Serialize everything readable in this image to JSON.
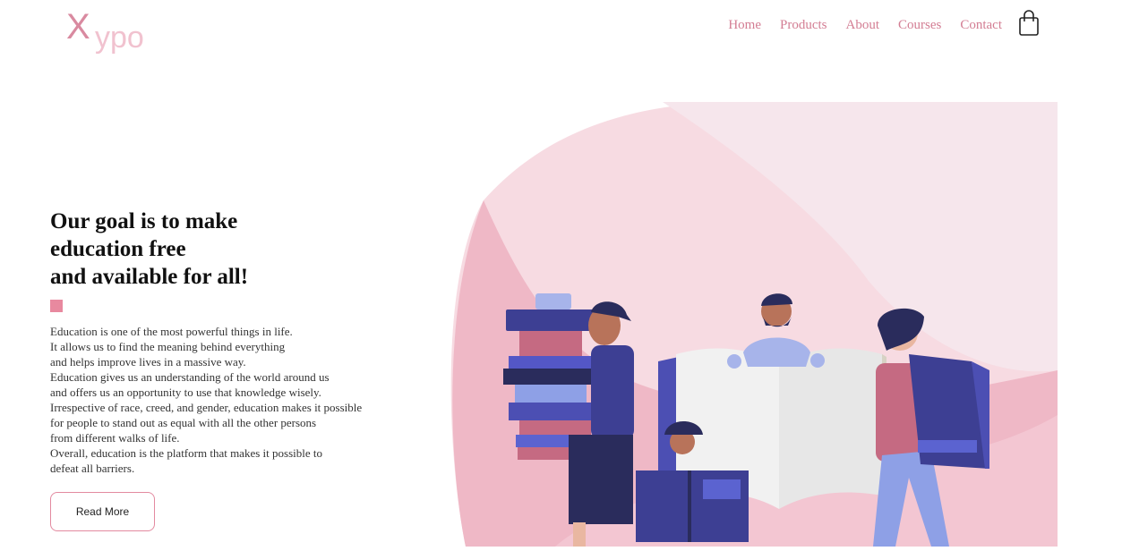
{
  "brand": {
    "logo_x": "X",
    "logo_rest": "ypo"
  },
  "nav": {
    "items": [
      "Home",
      "Products",
      "About",
      "Courses",
      "Contact"
    ],
    "cart_icon": "shopping-bag-icon"
  },
  "hero": {
    "title_lines": [
      "Our goal is to make",
      "education free",
      "and available for all!"
    ],
    "body_lines": [
      "Education is one of the most powerful things in life.",
      "It allows us to find the meaning behind everything",
      "and helps improve lives in a massive way.",
      "Education gives us an understanding of the world around us",
      "and offers us an opportunity to use that knowledge wisely.",
      "Irrespective of race, creed, and gender, education makes it possible",
      "for people to stand out as equal with all the other persons",
      "from different walks of life.",
      "Overall, education is the platform that makes it possible to",
      "defeat all barriers."
    ],
    "button_label": "Read More"
  },
  "colors": {
    "accent": "#e8899f",
    "nav_text": "#d37d93",
    "blob_light": "#f7dbe2",
    "blob_mid": "#efb8c6",
    "book_blue": "#3d3f93"
  }
}
